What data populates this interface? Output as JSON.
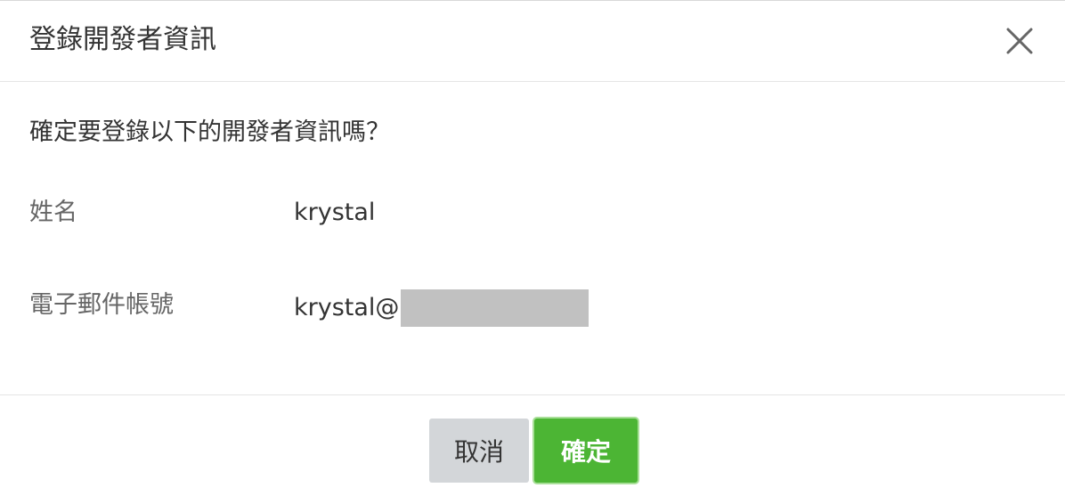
{
  "dialog": {
    "title": "登錄開發者資訊",
    "close_icon": "close-icon"
  },
  "body": {
    "confirm_text": "確定要登錄以下的開發者資訊嗎？",
    "fields": [
      {
        "label": "姓名",
        "value": "krystal"
      },
      {
        "label": "電子郵件帳號",
        "value": "krystal@"
      }
    ]
  },
  "footer": {
    "cancel_label": "取消",
    "ok_label": "確定"
  },
  "colors": {
    "primary": "#4cb534",
    "secondary": "#d3d6d9",
    "text": "#333333",
    "label": "#666666",
    "redacted": "#c1c1c1"
  }
}
